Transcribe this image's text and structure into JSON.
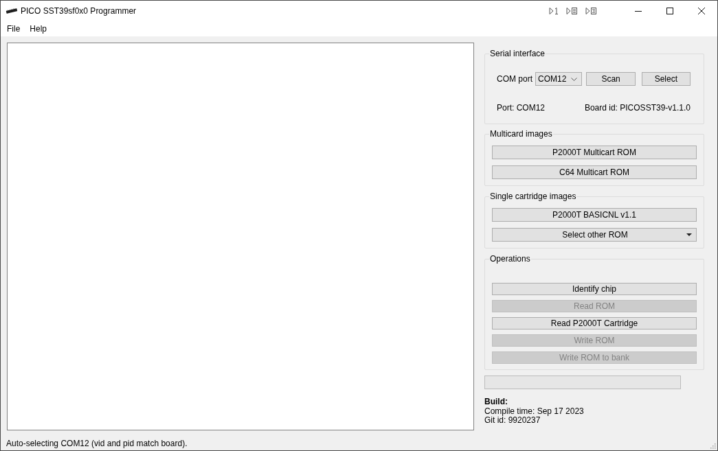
{
  "window": {
    "title": "PICO SST39sf0x0 Programmer"
  },
  "menu": [
    {
      "label": "File"
    },
    {
      "label": "Help"
    }
  ],
  "serial_interface": {
    "title": "Serial interface",
    "com_port_label": "COM port",
    "com_port": {
      "value": "COM12"
    },
    "buttons": [
      {
        "label": "Scan"
      },
      {
        "label": "Select"
      }
    ],
    "port": "Port: COM12",
    "board_id": "Board id: PICOSST39-v1.1.0"
  },
  "multicard_images": {
    "title": "Multicard images",
    "buttons": [
      {
        "label": "P2000T Multicart ROM"
      },
      {
        "label": "C64 Multicart ROM"
      }
    ]
  },
  "single_cartridge_images": {
    "title": "Single cartridge images",
    "buttons": [
      {
        "label": "P2000T BASICNL v1.1",
        "kind": "button"
      },
      {
        "label": "Select other ROM",
        "kind": "dropdown"
      }
    ]
  },
  "operations": {
    "title": "Operations",
    "buttons": [
      {
        "label": "Identify chip",
        "disabled": false
      },
      {
        "label": "Read ROM",
        "disabled": true
      },
      {
        "label": "Read P2000T Cartridge",
        "disabled": false
      },
      {
        "label": "Write ROM",
        "disabled": true
      },
      {
        "label": "Write ROM to bank",
        "disabled": true
      }
    ]
  },
  "progress": {
    "level": 0
  },
  "build": {
    "heading": "Build:",
    "compile_time": "Compile time: Sep 17 2023",
    "git_id": "Git id: 9920237"
  },
  "status_bar": "Auto-selecting COM12 (vid and pid match board)."
}
